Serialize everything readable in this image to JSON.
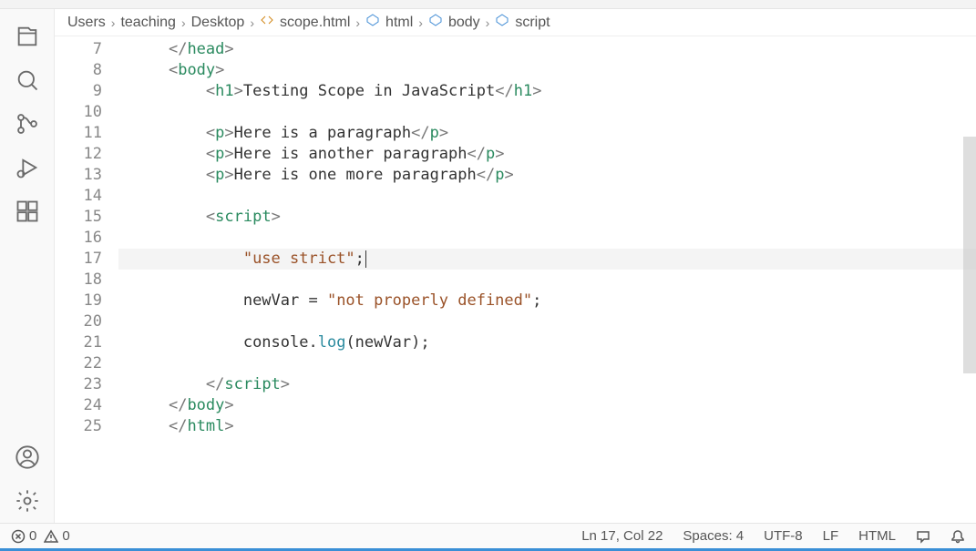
{
  "breadcrumbs": {
    "items": [
      {
        "label": "Users",
        "icon": null
      },
      {
        "label": "teaching",
        "icon": null
      },
      {
        "label": "Desktop",
        "icon": null
      },
      {
        "label": "scope.html",
        "icon": "file-code"
      },
      {
        "label": "html",
        "icon": "symbol"
      },
      {
        "label": "body",
        "icon": "symbol"
      },
      {
        "label": "script",
        "icon": "symbol"
      }
    ]
  },
  "editor": {
    "first_line_number": 7,
    "highlighted_line": 17,
    "lines": [
      {
        "n": 7,
        "indent": 1,
        "tokens": [
          {
            "t": "tag-br",
            "v": "</"
          },
          {
            "t": "tag-name",
            "v": "head"
          },
          {
            "t": "tag-br",
            "v": ">"
          }
        ]
      },
      {
        "n": 8,
        "indent": 1,
        "tokens": [
          {
            "t": "tag-br",
            "v": "<"
          },
          {
            "t": "tag-name",
            "v": "body"
          },
          {
            "t": "tag-br",
            "v": ">"
          }
        ]
      },
      {
        "n": 9,
        "indent": 2,
        "tokens": [
          {
            "t": "tag-br",
            "v": "<"
          },
          {
            "t": "tag-name",
            "v": "h1"
          },
          {
            "t": "tag-br",
            "v": ">"
          },
          {
            "t": "text-plain",
            "v": "Testing Scope in JavaScript"
          },
          {
            "t": "tag-br",
            "v": "</"
          },
          {
            "t": "tag-name",
            "v": "h1"
          },
          {
            "t": "tag-br",
            "v": ">"
          }
        ]
      },
      {
        "n": 10,
        "indent": 2,
        "tokens": []
      },
      {
        "n": 11,
        "indent": 2,
        "tokens": [
          {
            "t": "tag-br",
            "v": "<"
          },
          {
            "t": "tag-name",
            "v": "p"
          },
          {
            "t": "tag-br",
            "v": ">"
          },
          {
            "t": "text-plain",
            "v": "Here is a paragraph"
          },
          {
            "t": "tag-br",
            "v": "</"
          },
          {
            "t": "tag-name",
            "v": "p"
          },
          {
            "t": "tag-br",
            "v": ">"
          }
        ]
      },
      {
        "n": 12,
        "indent": 2,
        "tokens": [
          {
            "t": "tag-br",
            "v": "<"
          },
          {
            "t": "tag-name",
            "v": "p"
          },
          {
            "t": "tag-br",
            "v": ">"
          },
          {
            "t": "text-plain",
            "v": "Here is another paragraph"
          },
          {
            "t": "tag-br",
            "v": "</"
          },
          {
            "t": "tag-name",
            "v": "p"
          },
          {
            "t": "tag-br",
            "v": ">"
          }
        ]
      },
      {
        "n": 13,
        "indent": 2,
        "tokens": [
          {
            "t": "tag-br",
            "v": "<"
          },
          {
            "t": "tag-name",
            "v": "p"
          },
          {
            "t": "tag-br",
            "v": ">"
          },
          {
            "t": "text-plain",
            "v": "Here is one more paragraph"
          },
          {
            "t": "tag-br",
            "v": "</"
          },
          {
            "t": "tag-name",
            "v": "p"
          },
          {
            "t": "tag-br",
            "v": ">"
          }
        ]
      },
      {
        "n": 14,
        "indent": 2,
        "tokens": []
      },
      {
        "n": 15,
        "indent": 2,
        "tokens": [
          {
            "t": "tag-br",
            "v": "<"
          },
          {
            "t": "tag-name",
            "v": "script"
          },
          {
            "t": "tag-br",
            "v": ">"
          }
        ]
      },
      {
        "n": 16,
        "indent": 3,
        "tokens": []
      },
      {
        "n": 17,
        "indent": 3,
        "tokens": [
          {
            "t": "string",
            "v": "\"use strict\""
          },
          {
            "t": "text-plain",
            "v": ";"
          }
        ],
        "cursor_after": true
      },
      {
        "n": 18,
        "indent": 3,
        "tokens": []
      },
      {
        "n": 19,
        "indent": 3,
        "tokens": [
          {
            "t": "text-plain",
            "v": "newVar = "
          },
          {
            "t": "string",
            "v": "\"not properly defined\""
          },
          {
            "t": "text-plain",
            "v": ";"
          }
        ]
      },
      {
        "n": 20,
        "indent": 3,
        "tokens": []
      },
      {
        "n": 21,
        "indent": 3,
        "tokens": [
          {
            "t": "text-plain",
            "v": "console."
          },
          {
            "t": "func",
            "v": "log"
          },
          {
            "t": "text-plain",
            "v": "(newVar);"
          }
        ]
      },
      {
        "n": 22,
        "indent": 3,
        "tokens": []
      },
      {
        "n": 23,
        "indent": 2,
        "tokens": [
          {
            "t": "tag-br",
            "v": "</"
          },
          {
            "t": "tag-name",
            "v": "script"
          },
          {
            "t": "tag-br",
            "v": ">"
          }
        ]
      },
      {
        "n": 24,
        "indent": 1,
        "tokens": [
          {
            "t": "tag-br",
            "v": "</"
          },
          {
            "t": "tag-name",
            "v": "body"
          },
          {
            "t": "tag-br",
            "v": ">"
          }
        ]
      },
      {
        "n": 25,
        "indent": 1,
        "tokens": [
          {
            "t": "tag-br",
            "v": "</"
          },
          {
            "t": "tag-name",
            "v": "html"
          },
          {
            "t": "tag-br",
            "v": ">"
          }
        ]
      }
    ]
  },
  "status": {
    "errors": "0",
    "warnings": "0",
    "position": "Ln 17, Col 22",
    "indent": "Spaces: 4",
    "encoding": "UTF-8",
    "eol": "LF",
    "language": "HTML"
  }
}
